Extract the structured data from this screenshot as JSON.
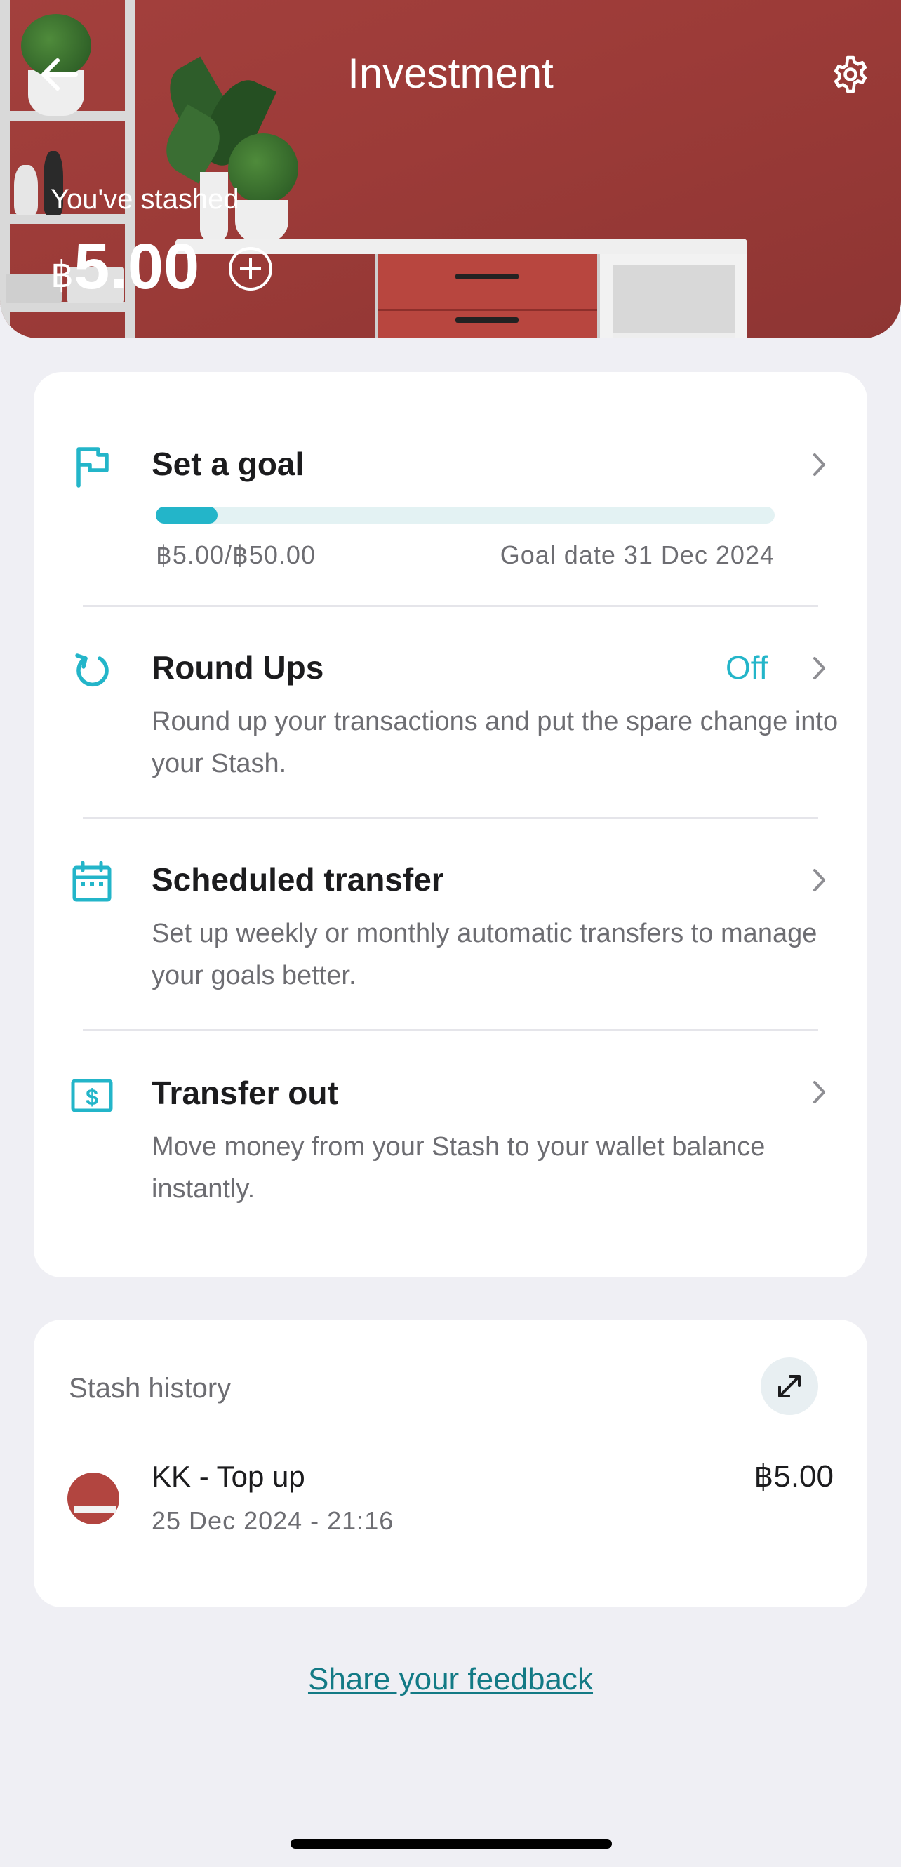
{
  "header": {
    "title": "Investment",
    "stashed_label": "You've stashed",
    "currency_symbol": "฿",
    "amount": "5.00",
    "icons": {
      "back": "arrow-left-icon",
      "settings": "gear-icon",
      "add": "plus-circle-icon"
    }
  },
  "actions": {
    "goal": {
      "title": "Set a goal",
      "progress_text": "฿5.00/฿50.00",
      "goal_date": "Goal date 31 Dec 2024",
      "progress_fraction": 0.1,
      "icon": "flag-icon"
    },
    "round_ups": {
      "title": "Round Ups",
      "status": "Off",
      "description": "Round up your transactions and put the spare change into your Stash.",
      "icon": "refresh-icon"
    },
    "scheduled": {
      "title": "Scheduled transfer",
      "description": "Set up weekly or monthly automatic transfers to manage your goals better.",
      "icon": "calendar-icon"
    },
    "transfer_out": {
      "title": "Transfer out",
      "description": "Move money from your Stash to your wallet balance instantly.",
      "icon": "dollar-bill-icon"
    }
  },
  "history": {
    "title": "Stash history",
    "transactions": [
      {
        "title": "KK - Top up",
        "date": "25 Dec 2024 - 21:16",
        "amount": "฿5.00"
      }
    ]
  },
  "footer": {
    "feedback_link": "Share your feedback"
  },
  "colors": {
    "accent": "#23b5c9",
    "header_bg": "#9c3b38",
    "link": "#137a85"
  }
}
